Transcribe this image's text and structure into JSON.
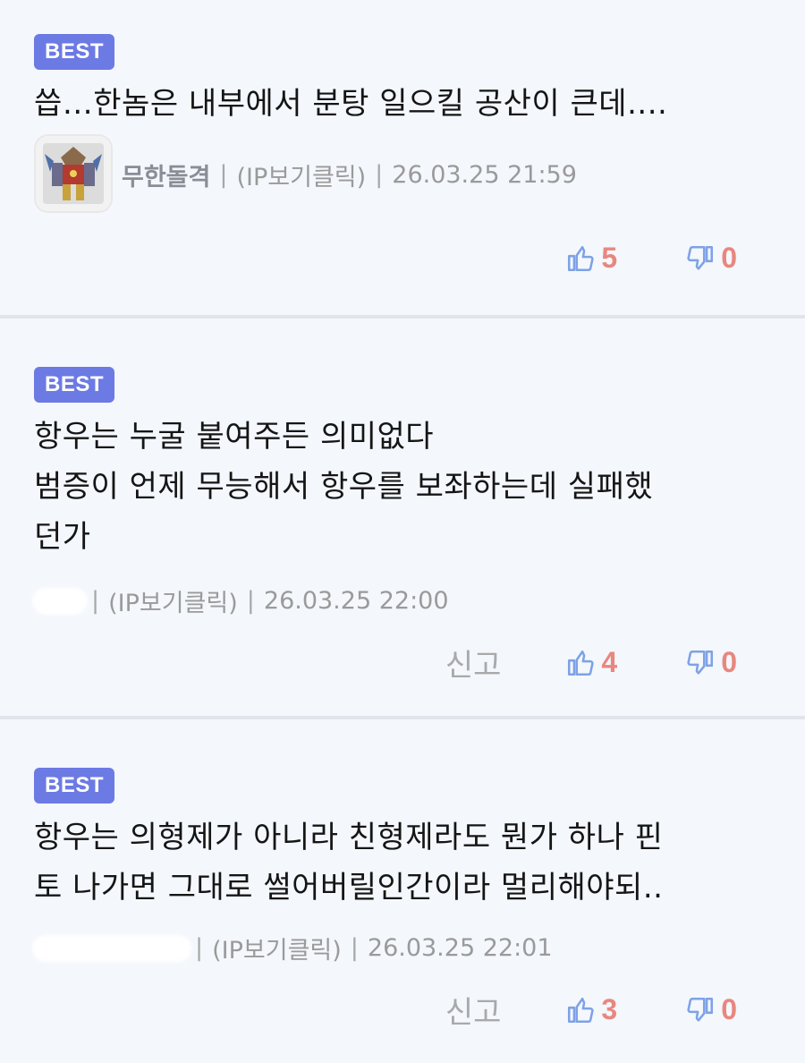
{
  "comments": [
    {
      "badge": "BEST",
      "lines": [
        "씁…한놈은 내부에서 분탕 일으킬 공산이 큰데...."
      ],
      "author": "무한돌격",
      "ip_label": "(IP보기클릭)",
      "date": "26.03.25 21:59",
      "report_label": "",
      "likes": "5",
      "dislikes": "0"
    },
    {
      "badge": "BEST",
      "lines": [
        "항우는 누굴 붙여주든 의미없다",
        "범증이 언제 무능해서 항우를 보좌하는데 실패했",
        "던가"
      ],
      "author": "",
      "ip_label": "(IP보기클릭)",
      "date": "26.03.25 22:00",
      "report_label": "신고",
      "likes": "4",
      "dislikes": "0"
    },
    {
      "badge": "BEST",
      "lines": [
        "항우는 의형제가 아니라 친형제라도 뭔가 하나 핀",
        "토 나가면 그대로 썰어버릴인간이라 멀리해야되.."
      ],
      "author": "",
      "ip_label": "(IP보기클릭)",
      "date": "26.03.25 22:01",
      "report_label": "신고",
      "likes": "3",
      "dislikes": "0"
    }
  ],
  "colors": {
    "badge_bg": "#6c7ae4",
    "vote_count": "#e8877f",
    "thumb_icon": "#7ea2e6",
    "background": "#f4f7fc"
  },
  "icons": {
    "like": "thumbs-up-icon",
    "dislike": "thumbs-down-icon"
  }
}
